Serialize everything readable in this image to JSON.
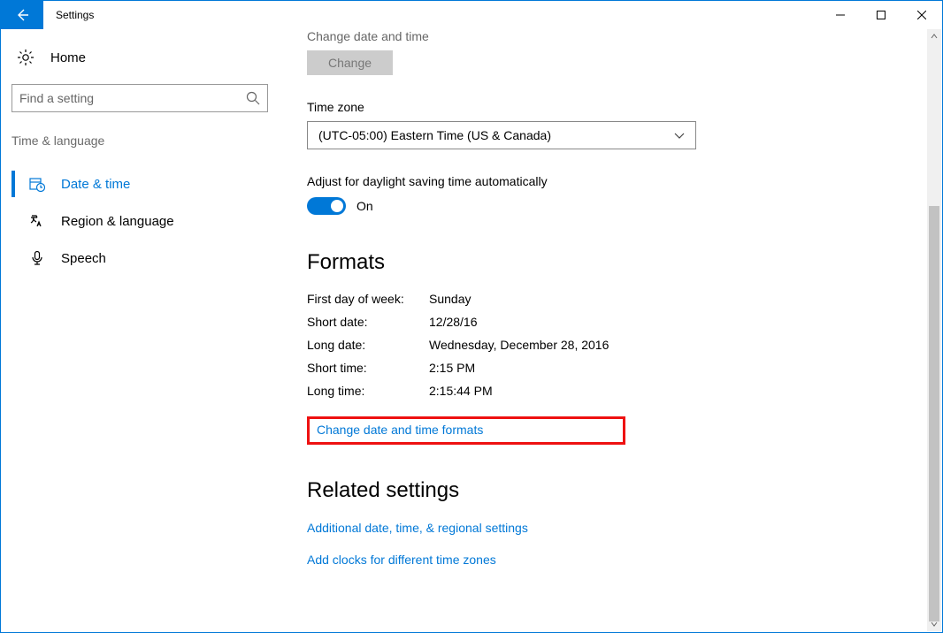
{
  "window": {
    "title": "Settings"
  },
  "sidebar": {
    "home_label": "Home",
    "search_placeholder": "Find a setting",
    "category_label": "Time & language",
    "items": [
      {
        "label": "Date & time"
      },
      {
        "label": "Region & language"
      },
      {
        "label": "Speech"
      }
    ]
  },
  "main": {
    "truncated_header": "Change date and time",
    "change_button": "Change",
    "timezone_label": "Time zone",
    "timezone_value": "(UTC-05:00) Eastern Time (US & Canada)",
    "dst_label": "Adjust for daylight saving time automatically",
    "dst_toggle_text": "On",
    "formats_heading": "Formats",
    "formats": [
      {
        "k": "First day of week:",
        "v": "Sunday"
      },
      {
        "k": "Short date:",
        "v": "12/28/16"
      },
      {
        "k": "Long date:",
        "v": "Wednesday, December 28, 2016"
      },
      {
        "k": "Short time:",
        "v": "2:15 PM"
      },
      {
        "k": "Long time:",
        "v": "2:15:44 PM"
      }
    ],
    "change_formats_link": "Change date and time formats",
    "related_heading": "Related settings",
    "related_links": [
      "Additional date, time, & regional settings",
      "Add clocks for different time zones"
    ]
  }
}
